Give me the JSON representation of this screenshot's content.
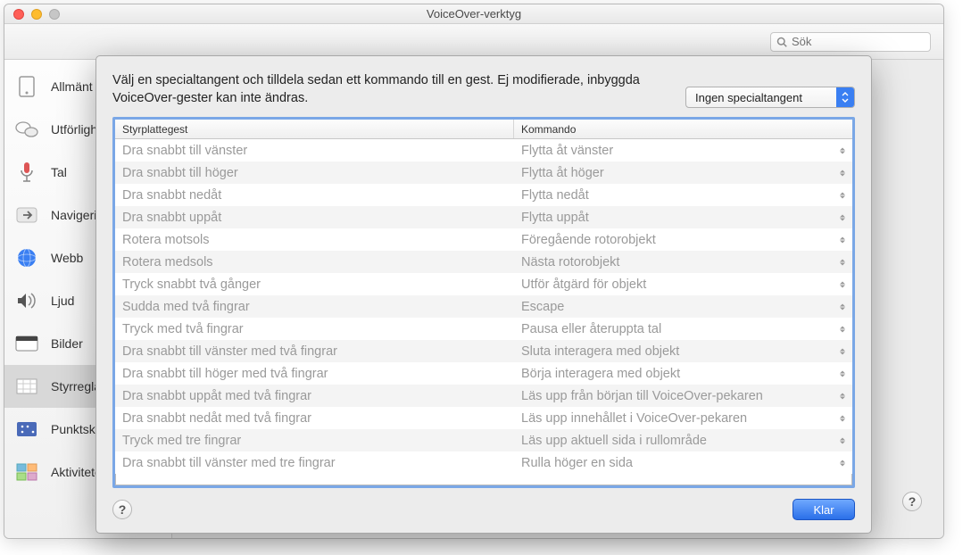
{
  "window": {
    "title": "VoiceOver-verktyg"
  },
  "search": {
    "placeholder": "Sök"
  },
  "sidebar": {
    "items": [
      {
        "label": "Allmänt"
      },
      {
        "label": "Utförlighet"
      },
      {
        "label": "Tal"
      },
      {
        "label": "Navigering"
      },
      {
        "label": "Webb"
      },
      {
        "label": "Ljud"
      },
      {
        "label": "Bilder"
      },
      {
        "label": "Styrreglage"
      },
      {
        "label": "Punktskrift"
      },
      {
        "label": "Aktiviteter"
      }
    ],
    "selected_index": 7
  },
  "sheet": {
    "instruction": "Välj en specialtangent och tilldela sedan ett kommando till en gest. Ej modifierade, inbyggda VoiceOver-gester kan inte ändras.",
    "modifier_popup": "Ingen specialtangent",
    "headers": {
      "gesture": "Styrplattegest",
      "command": "Kommando"
    },
    "rows": [
      {
        "gesture": "Dra snabbt till vänster",
        "command": "Flytta åt vänster"
      },
      {
        "gesture": "Dra snabbt till höger",
        "command": "Flytta åt höger"
      },
      {
        "gesture": "Dra snabbt nedåt",
        "command": "Flytta nedåt"
      },
      {
        "gesture": "Dra snabbt uppåt",
        "command": "Flytta uppåt"
      },
      {
        "gesture": "Rotera motsols",
        "command": "Föregående rotorobjekt"
      },
      {
        "gesture": "Rotera medsols",
        "command": "Nästa rotorobjekt"
      },
      {
        "gesture": "Tryck snabbt två gånger",
        "command": "Utför åtgärd för objekt"
      },
      {
        "gesture": "Sudda med två fingrar",
        "command": "Escape"
      },
      {
        "gesture": "Tryck med två fingrar",
        "command": "Pausa eller återuppta tal"
      },
      {
        "gesture": "Dra snabbt till vänster med två fingrar",
        "command": "Sluta interagera med objekt"
      },
      {
        "gesture": "Dra snabbt till höger med två fingrar",
        "command": "Börja interagera med objekt"
      },
      {
        "gesture": "Dra snabbt uppåt med två fingrar",
        "command": "Läs upp från början till VoiceOver-pekaren"
      },
      {
        "gesture": "Dra snabbt nedåt med två fingrar",
        "command": "Läs upp innehållet i VoiceOver-pekaren"
      },
      {
        "gesture": "Tryck med tre fingrar",
        "command": "Läs upp aktuell sida i rullområde"
      },
      {
        "gesture": "Dra snabbt till vänster med tre fingrar",
        "command": "Rulla höger en sida"
      }
    ],
    "done_label": "Klar"
  }
}
